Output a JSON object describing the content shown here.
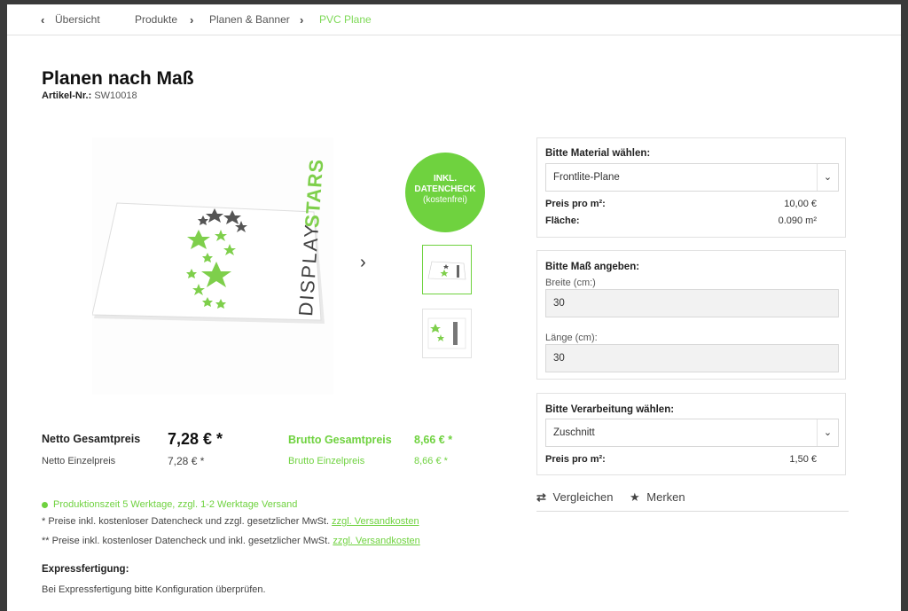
{
  "breadcrumb": {
    "back": "Übersicht",
    "items": [
      "Produkte",
      "Planen & Banner",
      "PVC Plane"
    ]
  },
  "product": {
    "title": "Planen nach Maß",
    "article_label": "Artikel-Nr.:",
    "article_number": "SW10018",
    "image_text": "DISPLAYSTARS",
    "image_text_a": "DISPLAY",
    "image_text_b": "STARS"
  },
  "badge": {
    "line1": "INKL.",
    "line2": "DATENCHECK",
    "line3": "(kostenfrei)"
  },
  "prices": {
    "netto_total_label": "Netto Gesamtpreis",
    "netto_total_value": "7,28 € *",
    "netto_unit_label": "Netto Einzelpreis",
    "netto_unit_value": "7,28 € *",
    "brutto_total_label": "Brutto Gesamtpreis",
    "brutto_total_value": "8,66 € *",
    "brutto_unit_label": "Brutto Einzelpreis",
    "brutto_unit_value": "8,66 € *"
  },
  "info": {
    "production": "Produktionszeit 5 Werktage, zzgl. 1-2 Werktage Versand",
    "note1": "* Preise inkl. kostenloser Datencheck und zzgl. gesetzlicher MwSt.",
    "note2": "** Preise inkl. kostenloser Datencheck und inkl. gesetzlicher MwSt.",
    "shipping_link": "zzgl. Versandkosten",
    "express_title": "Expressfertigung:",
    "express_text": "Bei Expressfertigung bitte Konfiguration überprüfen."
  },
  "config": {
    "material": {
      "title": "Bitte Material wählen:",
      "selected": "Frontlite-Plane",
      "price_label": "Preis pro m²:",
      "price_value": "10,00 €",
      "area_label": "Fläche:",
      "area_value": "0.090 m²"
    },
    "size": {
      "title": "Bitte Maß angeben:",
      "width_label": "Breite (cm:)",
      "width_value": "30",
      "length_label": "Länge (cm):",
      "length_value": "30"
    },
    "processing": {
      "title": "Bitte Verarbeitung wählen:",
      "selected": "Zuschnitt",
      "price_label": "Preis pro m²:",
      "price_value": "1,50 €"
    }
  },
  "actions": {
    "compare": "Vergleichen",
    "remember": "Merken"
  },
  "colors": {
    "accent": "#6fd23f",
    "star_gray": "#555555"
  }
}
